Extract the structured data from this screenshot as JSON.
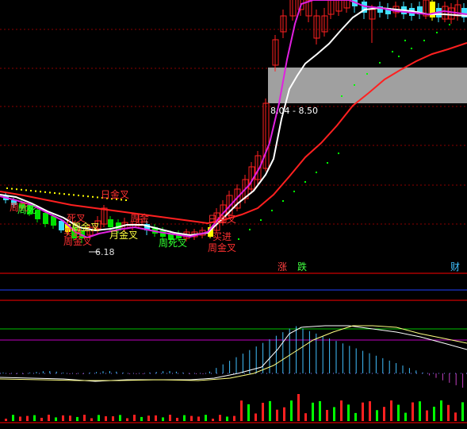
{
  "colors": {
    "background": "#000000",
    "grid_red": "#8b0000",
    "panel_border": "#ff0000",
    "blue_line": "#2040ff",
    "up_candle": "#ff2020",
    "down_candle_green": "#00e000",
    "down_candle_cyan": "#40e0ff",
    "ma_white": "#ffffff",
    "ma_magenta": "#e020e0",
    "ma_red": "#ff2020",
    "dots_yellow": "#ffff00",
    "dots_green": "#00ff00",
    "gray_zone": "#a0a0a0",
    "macd_pink": "#c040c0",
    "macd_cyan": "#40c0ff",
    "macd_yellow": "#ffff80",
    "macd_white": "#ffffff",
    "level_green": "#00c000",
    "level_magenta": "#c000c0",
    "vol_red": "#ff2020",
    "vol_green": "#00ff00"
  },
  "main_chart": {
    "gray_zone_label": "8.04 - 8.50",
    "low_price_label": "6.18",
    "annotations": [
      {
        "text": "日金叉",
        "color": "red"
      },
      {
        "text": "周金叉",
        "color": "yellow"
      },
      {
        "text": "买进",
        "color": "red"
      },
      {
        "text": "周金叉",
        "color": "red"
      },
      {
        "text": "月金叉",
        "color": "yellow"
      },
      {
        "text": "周死叉",
        "color": "green"
      },
      {
        "text": "死叉",
        "color": "red"
      },
      {
        "text": "周金",
        "color": "red"
      },
      {
        "text": "日金叉",
        "color": "red"
      },
      {
        "text": "买进",
        "color": "red"
      },
      {
        "text": "周金叉",
        "color": "red"
      },
      {
        "text": "周死",
        "color": "green"
      },
      {
        "text": "周死",
        "color": "red"
      }
    ]
  },
  "indicator_header": {
    "rise": "涨",
    "fall": "跌",
    "finance": "财"
  }
}
